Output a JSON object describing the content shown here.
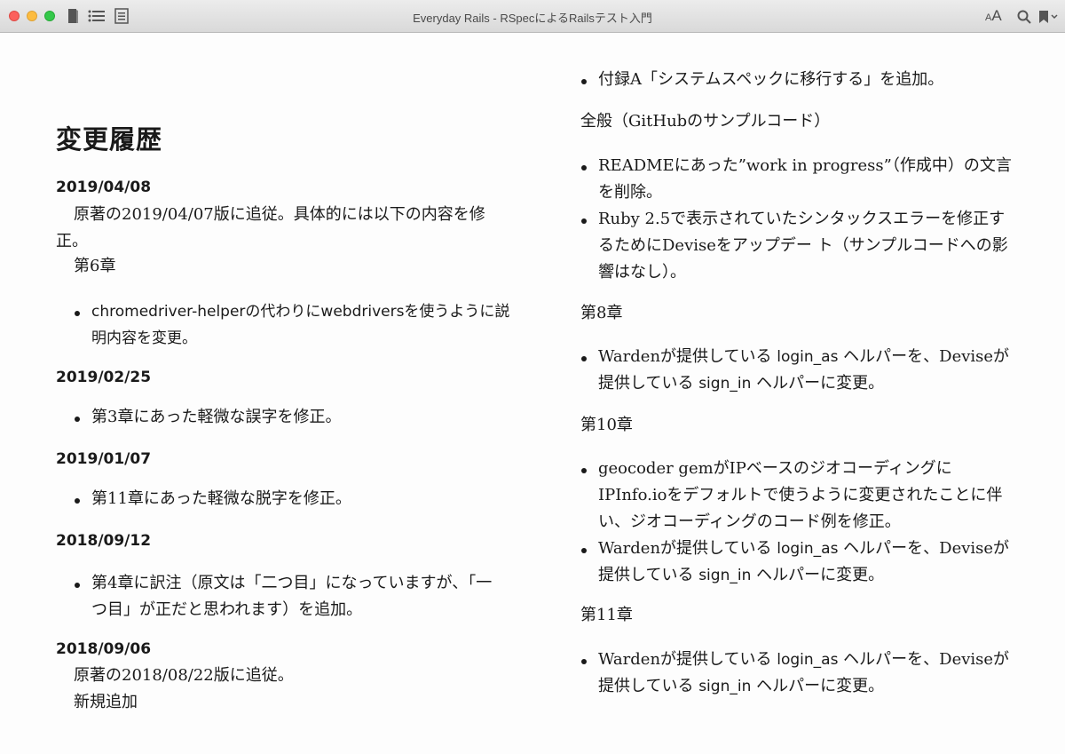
{
  "window": {
    "title": "Everyday Rails - RSpecによるRailsテスト入門",
    "font_small": "A",
    "font_large": "A"
  },
  "icons": {
    "book": "book-icon",
    "toc": "list-icon",
    "notes": "notes-icon",
    "search": "search-icon",
    "bookmark": "bookmark-icon"
  },
  "left": {
    "title": "変更履歴",
    "d1": "2019/04/08",
    "d1_para": "原著の2019/04/07版に追従。具体的には以下の内容を修正。",
    "d1_chapter": "第6章",
    "d1_item1": "chromedriver-helperの代わりにwebdriversを使うように説明内容を変更。",
    "d2": "2019/02/25",
    "d2_item1": "第3章にあった軽微な誤字を修正。",
    "d3": "2019/01/07",
    "d3_item1": "第11章にあった軽微な脱字を修正。",
    "d4": "2018/09/12",
    "d4_item1": "第4章に訳注（原文は「二つ目」になっていますが、「一つ目」が正だと思われます）を追加。",
    "d5": "2018/09/06",
    "d5_para": "原著の2018/08/22版に追従。",
    "d5_new": "新規追加"
  },
  "right": {
    "item_appendix": "付録A「システムスペックに移行する」を追加。",
    "general": "全般（GitHubのサンプルコード）",
    "g_item1": "READMEにあった”work in progress”（作成中）の文言を削除。",
    "g_item2": "Ruby 2.5で表示されていたシンタックスエラーを修正するためにDeviseをアップデー ト（サンプルコードへの影響はなし）。",
    "ch8": "第8章",
    "ch8_item1_a": "Wardenが提供している",
    "ch8_item1_code1": "login_as",
    "ch8_item1_b": "ヘルパーを、Deviseが提供している",
    "ch8_item1_code2": "sign_in",
    "ch8_item1_c": "ヘルパーに変更。",
    "ch10": "第10章",
    "ch10_item1": "geocoder gemがIPベースのジオコーディングにIPInfo.ioをデフォルトで使うように変更されたことに伴い、ジオコーディングのコード例を修正。",
    "ch10_item2_a": "Wardenが提供している",
    "ch10_item2_code1": "login_as",
    "ch10_item2_b": "ヘルパーを、Deviseが提供している",
    "ch10_item2_code2": "sign_in",
    "ch10_item2_c": "ヘルパーに変更。",
    "ch11": "第11章",
    "ch11_item1_a": "Wardenが提供している",
    "ch11_item1_code1": "login_as",
    "ch11_item1_b": "ヘルパーを、Deviseが提供している",
    "ch11_item1_code2": "sign_in",
    "ch11_item1_c": "ヘルパーに変更。"
  }
}
